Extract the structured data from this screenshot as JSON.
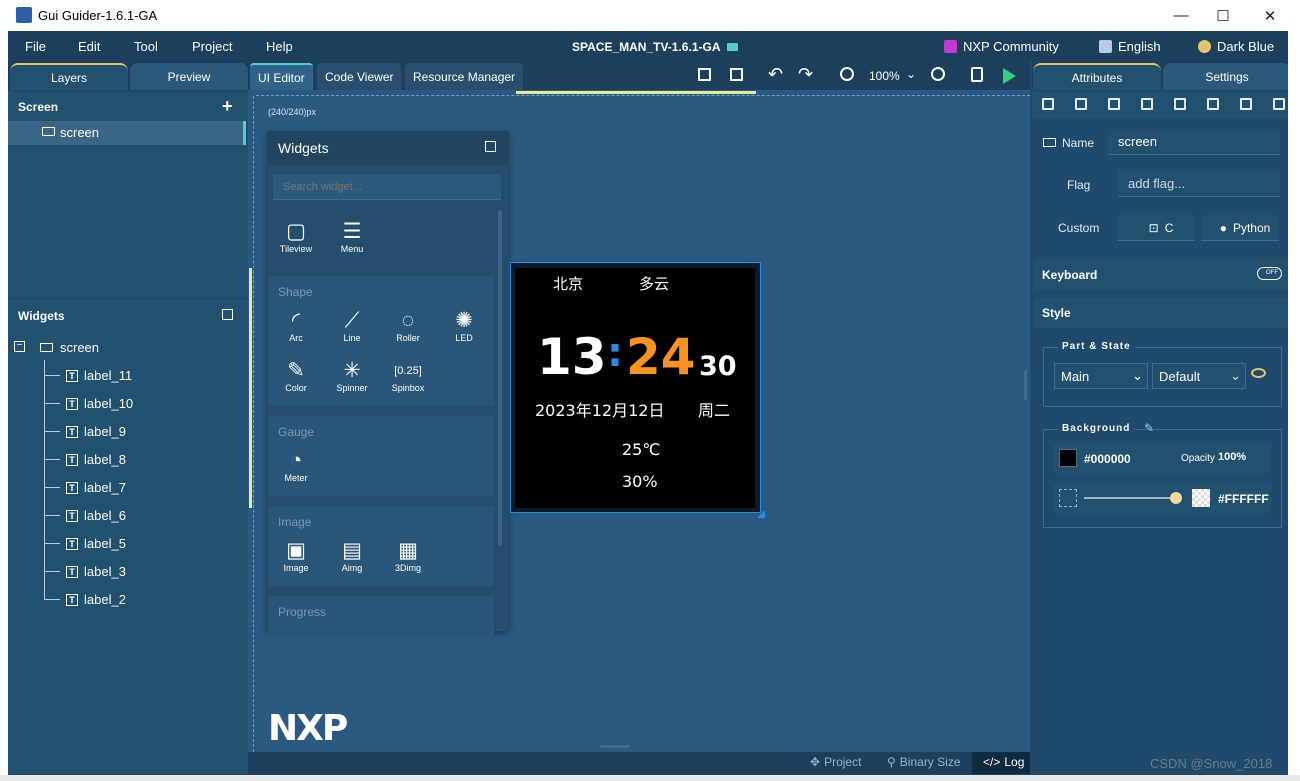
{
  "window": {
    "title": "Gui Guider-1.6.1-GA",
    "min_glyph": "—",
    "max_glyph": "☐",
    "close_glyph": "✕"
  },
  "menubar": {
    "items": [
      "File",
      "Edit",
      "Tool",
      "Project",
      "Help"
    ],
    "project_title": "SPACE_MAN_TV-1.6.1-GA",
    "community": "NXP Community",
    "language": "English",
    "theme": "Dark Blue"
  },
  "left": {
    "tabs": [
      "Layers",
      "Preview"
    ],
    "layers_title": "Screen",
    "add_glyph": "+",
    "screen_item": "screen",
    "widgets_title": "Widgets",
    "tree_root": "screen",
    "tree_items": [
      "label_11",
      "label_10",
      "label_9",
      "label_8",
      "label_7",
      "label_6",
      "label_5",
      "label_3",
      "label_2"
    ]
  },
  "editor": {
    "tabs": [
      "UI Editor",
      "Code Viewer",
      "Resource Manager"
    ],
    "zoom": "100%",
    "size_label": "(240/240)px"
  },
  "palette": {
    "title": "Widgets",
    "search_placeholder": "Search widget...",
    "top_items": [
      "Tileview",
      "Menu"
    ],
    "groups": [
      {
        "title": "Shape",
        "items": [
          "Arc",
          "Line",
          "Roller",
          "LED",
          "Color",
          "Spinner",
          "Spinbox"
        ]
      },
      {
        "title": "Gauge",
        "items": [
          "Meter"
        ]
      },
      {
        "title": "Image",
        "items": [
          "Image",
          "Aimg",
          "3Dimg"
        ]
      },
      {
        "title": "Progress",
        "items": []
      }
    ]
  },
  "device": {
    "city": "北京",
    "weather": "多云",
    "hour": "13",
    "colon": ":",
    "minute": "24",
    "second": "30",
    "date": "2023年12月12日",
    "weekday": "周二",
    "temperature": "25℃",
    "humidity": "30%",
    "colors": {
      "minute": "#f7931e",
      "colon": "#2b8be3",
      "bg": "#000000"
    }
  },
  "logo_text": "NXP",
  "status": {
    "project": "Project",
    "binary": "Binary Size",
    "log": "Log"
  },
  "right": {
    "tabs": [
      "Attributes",
      "Settings"
    ],
    "name_label": "Name",
    "name_value": "screen",
    "flag_label": "Flag",
    "flag_placeholder": "add flag...",
    "custom_label": "Custom",
    "custom_c": "C",
    "custom_python": "Python",
    "keyboard_label": "Keyboard",
    "keyboard_toggle": "OFF",
    "style_label": "Style",
    "part_state_legend": "Part & State",
    "part_value": "Main",
    "state_value": "Default",
    "background_legend": "Background",
    "bg_color": "#000000",
    "opacity_label": "Opacity",
    "opacity_value": "100%",
    "grad_color": "#FFFFFF",
    "grad_level": 1.0
  },
  "watermark": "CSDN @Snow_2018",
  "colors": {
    "accent": "#4fd1c5",
    "panel": "#22506f",
    "canvas": "#2a5a81",
    "selection": "#2b8be3"
  }
}
